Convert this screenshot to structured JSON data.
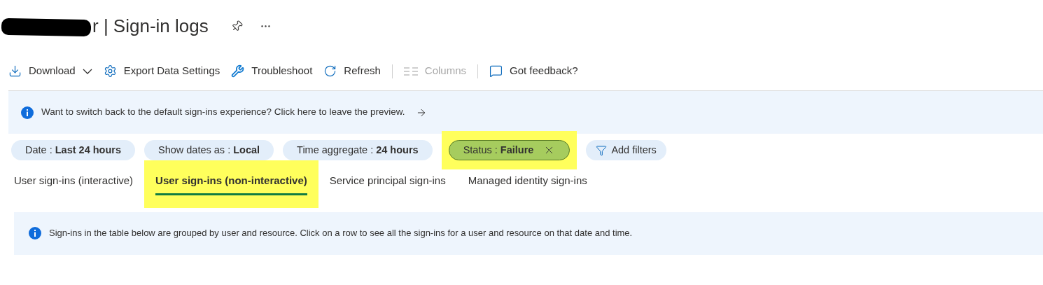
{
  "header": {
    "title": "r | Sign-in logs",
    "redacted": true
  },
  "toolbar": [
    {
      "kind": "download",
      "label": "Download",
      "dropdown": true,
      "disabled": false
    },
    {
      "kind": "settings",
      "label": "Export Data Settings",
      "dropdown": false,
      "disabled": false
    },
    {
      "kind": "troubleshoot",
      "label": "Troubleshoot",
      "dropdown": false,
      "disabled": false
    },
    {
      "kind": "refresh",
      "label": "Refresh",
      "dropdown": false,
      "disabled": false
    },
    {
      "kind": "columns",
      "label": "Columns",
      "dropdown": false,
      "disabled": true
    },
    {
      "kind": "feedback",
      "label": "Got feedback?",
      "dropdown": false,
      "disabled": false
    }
  ],
  "preview_banner": {
    "text": "Want to switch back to the default sign-ins experience? Click here to leave the preview."
  },
  "filters": [
    {
      "label": "Date : ",
      "value": "Last 24 hours",
      "removable": false,
      "highlighted": false
    },
    {
      "label": "Show dates as : ",
      "value": "Local",
      "removable": false,
      "highlighted": false
    },
    {
      "label": "Time aggregate : ",
      "value": "24 hours",
      "removable": false,
      "highlighted": false
    },
    {
      "label": "Status : ",
      "value": "Failure",
      "removable": true,
      "highlighted": true
    }
  ],
  "add_filters": {
    "label": "Add filters"
  },
  "tabs": [
    {
      "label": "User sign-ins (interactive)",
      "selected": false,
      "highlighted": false
    },
    {
      "label": "User sign-ins (non-interactive)",
      "selected": true,
      "highlighted": true
    },
    {
      "label": "Service principal sign-ins",
      "selected": false,
      "highlighted": false
    },
    {
      "label": "Managed identity sign-ins",
      "selected": false,
      "highlighted": false
    }
  ],
  "info_banner": {
    "text": "Sign-ins in the table below are grouped by user and resource. Click on a row to see all the sign-ins for a user and resource on that date and time."
  }
}
